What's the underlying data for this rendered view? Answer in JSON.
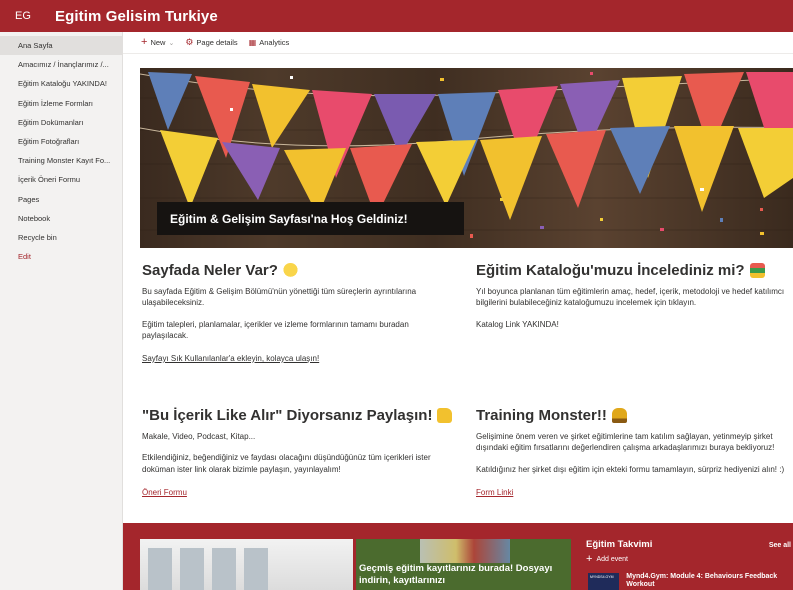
{
  "header": {
    "logo_initials": "EG",
    "site_title": "Egitim Gelisim Turkiye",
    "brand_color": "#a4262c"
  },
  "nav": {
    "items": [
      {
        "label": "Ana Sayfa"
      },
      {
        "label": "Amacımız / İnançlarımız /..."
      },
      {
        "label": "Eğitim Kataloğu YAKINDA!"
      },
      {
        "label": "Eğitim İzleme Formları"
      },
      {
        "label": "Eğitim Dokümanları"
      },
      {
        "label": "Eğitim Fotoğrafları"
      },
      {
        "label": "Training Monster Kayıt Fo..."
      },
      {
        "label": "İçerik Öneri Formu"
      },
      {
        "label": "Pages"
      },
      {
        "label": "Notebook"
      },
      {
        "label": "Recycle bin"
      }
    ],
    "edit_label": "Edit"
  },
  "commandbar": {
    "new_label": "New",
    "page_details_label": "Page details",
    "analytics_label": "Analytics"
  },
  "hero": {
    "caption": "Eğitim & Gelişim Sayfası'na Hoş Geldiniz!"
  },
  "sections": {
    "s1": {
      "title": "Sayfada Neler Var?",
      "p1": "Bu sayfada Eğitim & Gelişim Bölümü'nün yönettiği tüm süreçlerin ayrıntılarına ulaşabileceksiniz.",
      "p2": "Eğitim talepleri, planlamalar, içerikler ve izleme formlarının tamamı buradan paylaşılacak.",
      "link": "Sayfayı Sık Kullanılanlar'a ekleyin, kolayca ulaşın!"
    },
    "s2": {
      "title": "Eğitim Kataloğu'muzu İncelediniz mi?",
      "p1": "Yıl boyunca planlanan tüm eğitimlerin amaç, hedef, içerik, metodoloji ve hedef katılımcı bilgilerini bulabileceğiniz kataloğumuzu incelemek için tıklayın.",
      "p2": "Katalog Link YAKINDA!"
    },
    "s3": {
      "title": "\"Bu İçerik Like Alır\" Diyorsanız Paylaşın!",
      "p1": "Makale, Video, Podcast, Kitap...",
      "p2": "Etkilendiğiniz, beğendiğiniz ve faydası olacağını düşündüğünüz tüm içerikleri ister doküman ister link olarak bizimle paylaşın, yayınlayalım!",
      "link": "Öneri Formu"
    },
    "s4": {
      "title": "Training Monster!!",
      "p1": "Gelişimine önem veren ve şirket eğitimlerine tam katılım sağlayan, yetinmeyip şirket dışındaki eğitim fırsatlarını değerlendiren çalışma arkadaşlarımızı buraya bekliyoruz!",
      "p2": "Katıldığınız her şirket dışı eğitim için ekteki formu tamamlayın, sürpriz hediyenizi alın! :)",
      "link": "Form Linki"
    }
  },
  "bottom": {
    "tile2_text": "Geçmiş eğitim kayıtlarınız burada! Dosyayı indirin, kayıtlarınızı",
    "calendar": {
      "title": "Eğitim Takvimi",
      "see_all": "See all",
      "add_event": "Add event",
      "event_title": "Mynd4.Gym: Module 4: Behaviours Feedback Workout",
      "event_thumb": "MYNDS4.GYM"
    }
  }
}
